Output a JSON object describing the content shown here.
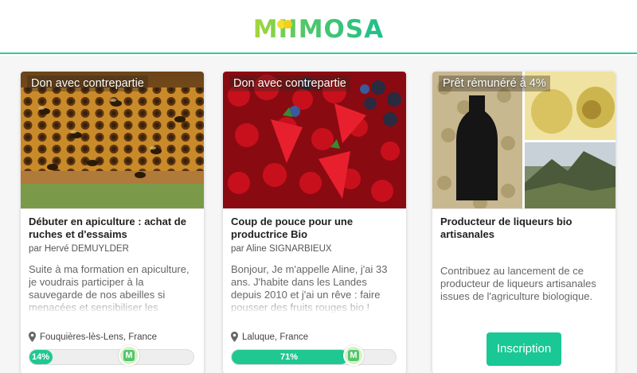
{
  "brand": {
    "logo_text": "MIIMOSA"
  },
  "cards": [
    {
      "badge": "Don avec contrepartie",
      "title": "Débuter en apiculture : achat de ruches et d'essaims",
      "author": "par Hervé DEMUYLDER",
      "description": "Suite à ma formation en apiculture, je voudrais participer à la sauvegarde de nos abeilles si menacées et sensibiliser les",
      "location": "Fouquières-lès-Lens, France",
      "progress_percent": 14,
      "progress_label": "14%"
    },
    {
      "badge": "Don avec contrepartie",
      "title": "Coup de pouce pour une productrice Bio",
      "author": "par Aline SIGNARBIEUX",
      "description": "Bonjour, Je m'appelle Aline, j'ai 33 ans. J'habite dans les Landes depuis 2010 et j'ai un rêve : faire pousser des fruits rouges bio !",
      "location": "Laluque, France",
      "progress_percent": 71,
      "progress_label": "71%"
    },
    {
      "badge": "Prêt rémunéré à 4%",
      "title": "Producteur de liqueurs bio artisanales",
      "description": "Contribuez au lancement de ce producteur de liqueurs artisanales issues de l'agriculture biologique.",
      "button_label": "Inscription"
    }
  ],
  "progress_marker_letter": "M",
  "colors": {
    "accent": "#1fc891",
    "header_line": "#36c7a0",
    "button": "#19c895"
  }
}
